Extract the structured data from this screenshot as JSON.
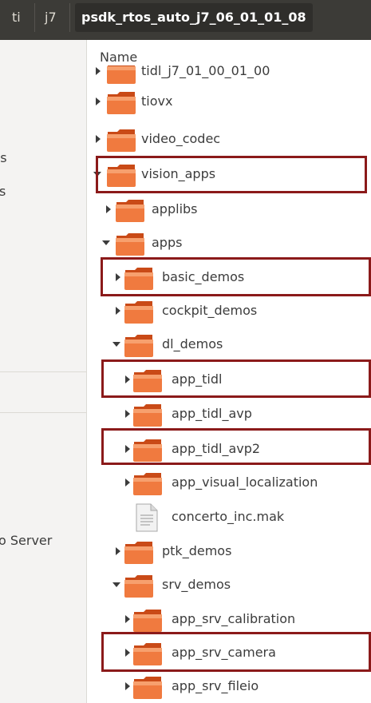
{
  "pathbar": {
    "crumbs": [
      "ti",
      "j7",
      "psdk_rtos_auto_j7_06_01_01_08"
    ]
  },
  "sidebar": {
    "fragments": [
      "ts",
      "s",
      "o Server"
    ]
  },
  "list": {
    "column_header": "Name",
    "rows": [
      {
        "label": "tidl_j7_01_00_01_00",
        "type": "folder",
        "expanded": false
      },
      {
        "label": "tiovx",
        "type": "folder",
        "expanded": false
      },
      {
        "label": "video_codec",
        "type": "folder",
        "expanded": false
      },
      {
        "label": "vision_apps",
        "type": "folder",
        "expanded": true,
        "highlighted": true
      },
      {
        "label": "applibs",
        "type": "folder",
        "expanded": false
      },
      {
        "label": "apps",
        "type": "folder",
        "expanded": true
      },
      {
        "label": "basic_demos",
        "type": "folder",
        "expanded": false,
        "highlighted": true
      },
      {
        "label": "cockpit_demos",
        "type": "folder",
        "expanded": false
      },
      {
        "label": "dl_demos",
        "type": "folder",
        "expanded": true
      },
      {
        "label": "app_tidl",
        "type": "folder",
        "expanded": false,
        "highlighted": true
      },
      {
        "label": "app_tidl_avp",
        "type": "folder",
        "expanded": false
      },
      {
        "label": "app_tidl_avp2",
        "type": "folder",
        "expanded": false,
        "highlighted": true
      },
      {
        "label": "app_visual_localization",
        "type": "folder",
        "expanded": false
      },
      {
        "label": "concerto_inc.mak",
        "type": "file"
      },
      {
        "label": "ptk_demos",
        "type": "folder",
        "expanded": false
      },
      {
        "label": "srv_demos",
        "type": "folder",
        "expanded": true
      },
      {
        "label": "app_srv_calibration",
        "type": "folder",
        "expanded": false
      },
      {
        "label": "app_srv_camera",
        "type": "folder",
        "expanded": false,
        "highlighted": true
      },
      {
        "label": "app_srv_fileio",
        "type": "folder",
        "expanded": false
      }
    ]
  },
  "colors": {
    "highlight_box": "#8b1a1a",
    "pathbar_bg": "#3c3b37",
    "folder_orange": "#e95420"
  }
}
